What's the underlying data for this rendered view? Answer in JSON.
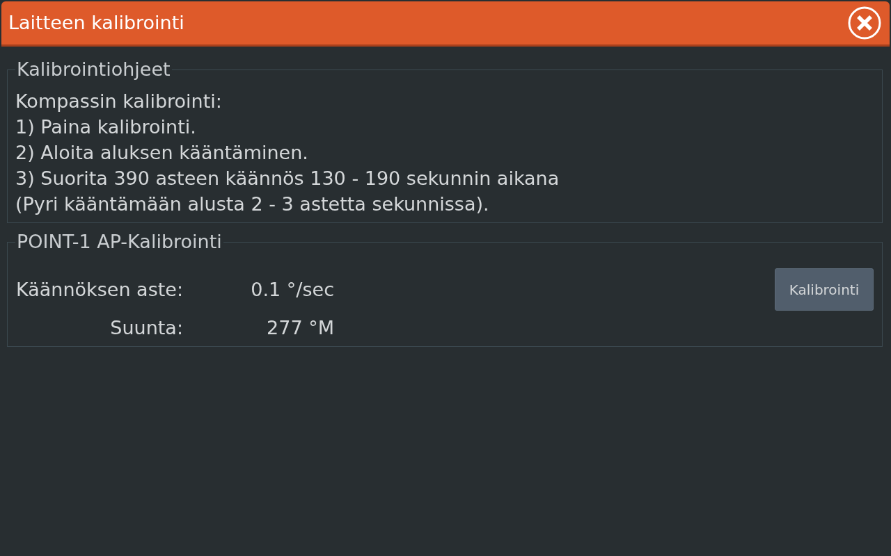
{
  "window": {
    "title": "Laitteen kalibrointi"
  },
  "sections": [
    {
      "kind": "text",
      "title": "Kalibrointiohjeet",
      "lines": [
        "Kompassin kalibrointi:",
        "1) Paina kalibrointi.",
        "2) Aloita aluksen kääntäminen.",
        "3) Suorita 390 asteen käännös 130 - 190 sekunnin aikana",
        "(Pyri kääntämään alusta 2 - 3 astetta sekunnissa)."
      ]
    },
    {
      "kind": "readings",
      "title": "POINT-1 AP-Kalibrointi",
      "rows": [
        {
          "label": "Käännöksen aste:",
          "value": "0.1 °/sec"
        },
        {
          "label": "Suunta:",
          "value": "277 °M"
        }
      ],
      "button": "Kalibrointi"
    }
  ]
}
